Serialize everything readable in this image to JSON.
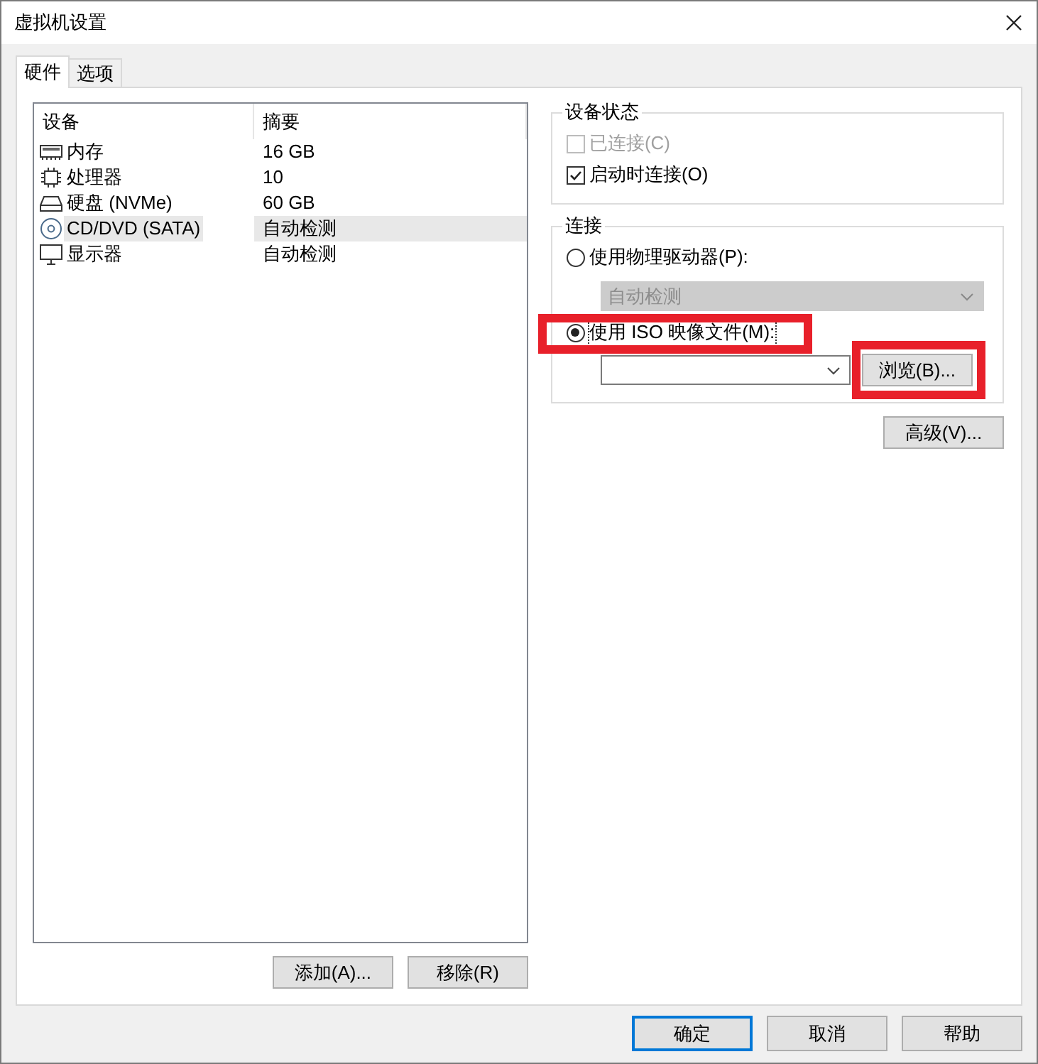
{
  "window": {
    "title": "虚拟机设置"
  },
  "tabs": [
    {
      "label": "硬件",
      "selected": true
    },
    {
      "label": "选项",
      "selected": false
    }
  ],
  "device_list": {
    "columns": [
      "设备",
      "摘要"
    ],
    "rows": [
      {
        "kind": "memory",
        "device": "内存",
        "summary": "16 GB",
        "selected": false
      },
      {
        "kind": "cpu",
        "device": "处理器",
        "summary": "10",
        "selected": false
      },
      {
        "kind": "disk",
        "device": "硬盘 (NVMe)",
        "summary": "60 GB",
        "selected": false
      },
      {
        "kind": "cd",
        "device": "CD/DVD (SATA)",
        "summary": "自动检测",
        "selected": true
      },
      {
        "kind": "display",
        "device": "显示器",
        "summary": "自动检测",
        "selected": false
      }
    ],
    "buttons": [
      "添加(A)...",
      "移除(R)"
    ]
  },
  "device_status": {
    "title": "设备状态",
    "options": [
      {
        "label": "已连接(C)",
        "checked": false,
        "disabled": true
      },
      {
        "label": "启动时连接(O)",
        "checked": true,
        "disabled": false
      }
    ]
  },
  "connection": {
    "title": "连接",
    "physical": {
      "label": "使用物理驱动器(P):",
      "selected": false,
      "dropdown": {
        "value": "自动检测",
        "disabled": true
      }
    },
    "iso": {
      "label": "使用 ISO 映像文件(M):",
      "selected": true,
      "highlighted": true,
      "browse": {
        "label": "浏览(B)...",
        "highlighted": true
      }
    }
  },
  "advanced_button": "高级(V)...",
  "footer_buttons": [
    {
      "label": "确定",
      "default": true
    },
    {
      "label": "取消",
      "default": false
    },
    {
      "label": "帮助",
      "default": false
    }
  ]
}
